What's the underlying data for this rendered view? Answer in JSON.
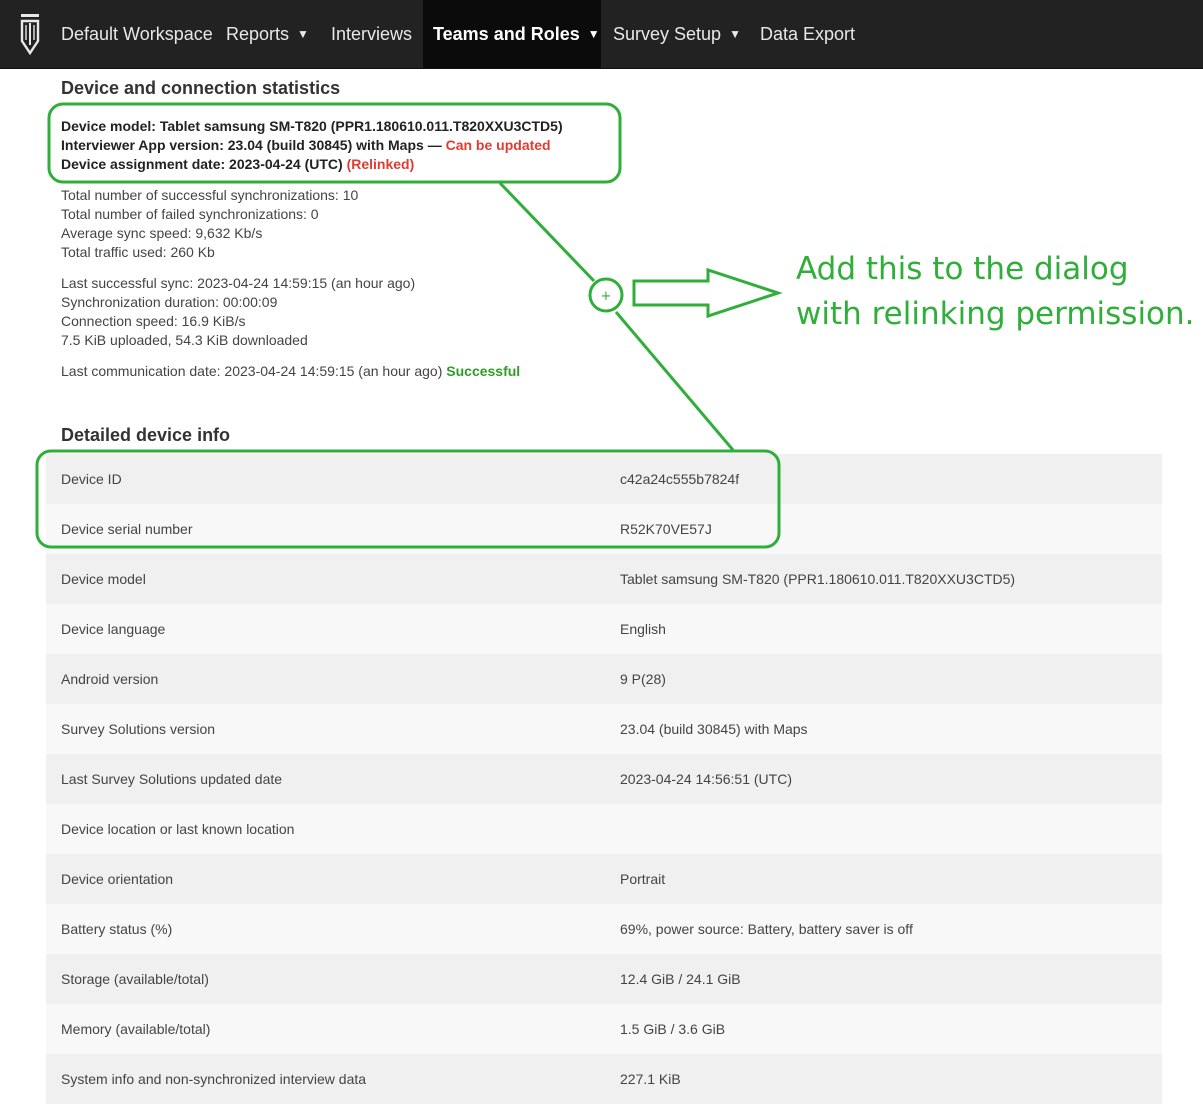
{
  "nav": {
    "items": [
      {
        "label": "Default Workspace",
        "caret": false
      },
      {
        "label": "Reports",
        "caret": true
      },
      {
        "label": "Interviews",
        "caret": false
      },
      {
        "label": "Teams and Roles",
        "caret": true,
        "active": true
      },
      {
        "label": "Survey Setup",
        "caret": true
      },
      {
        "label": "Data Export",
        "caret": false
      }
    ],
    "caret_glyph": "▼"
  },
  "stats": {
    "title": "Device and connection statistics",
    "device_model": "Device model: Tablet samsung SM-T820 (PPR1.180610.011.T820XXU3CTD5)",
    "app_version": "Interviewer App version: 23.04 (build 30845) with Maps —",
    "app_update": "Can be updated",
    "assignment_date": "Device assignment date: 2023-04-24 (UTC)",
    "relinked": "(Relinked)",
    "sync_success": "Total number of successful synchronizations: 10",
    "sync_failed": "Total number of failed synchronizations: 0",
    "avg_speed": "Average sync speed: 9,632 Kb/s",
    "traffic": "Total traffic used: 260 Kb",
    "last_sync": "Last successful sync: 2023-04-24 14:59:15 (an hour ago)",
    "sync_duration": "Synchronization duration: 00:00:09",
    "conn_speed": "Connection speed: 16.9 KiB/s",
    "transfer": "7.5 KiB uploaded, 54.3 KiB downloaded",
    "last_comm": "Last communication date: 2023-04-24 14:59:15 (an hour ago)",
    "last_comm_status": "Successful"
  },
  "details": {
    "title": "Detailed device info",
    "rows": [
      {
        "label": "Device ID",
        "value": "c42a24c555b7824f"
      },
      {
        "label": "Device serial number",
        "value": "R52K70VE57J"
      },
      {
        "label": "Device model",
        "value": "Tablet samsung SM-T820 (PPR1.180610.011.T820XXU3CTD5)"
      },
      {
        "label": "Device language",
        "value": "English"
      },
      {
        "label": "Android version",
        "value": "9 P(28)"
      },
      {
        "label": "Survey Solutions version",
        "value": "23.04 (build 30845) with Maps"
      },
      {
        "label": "Last Survey Solutions updated date",
        "value": "2023-04-24 14:56:51 (UTC)"
      },
      {
        "label": "Device location or last known location",
        "value": ""
      },
      {
        "label": "Device orientation",
        "value": "Portrait"
      },
      {
        "label": "Battery status (%)",
        "value": "69%, power source: Battery, battery saver is off"
      },
      {
        "label": "Storage (available/total)",
        "value": "12.4 GiB / 24.1 GiB"
      },
      {
        "label": "Memory (available/total)",
        "value": "1.5 GiB / 3.6 GiB"
      },
      {
        "label": "System info and non-synchronized interview data",
        "value": "227.1 KiB"
      }
    ]
  },
  "annotation": {
    "text": "Add this to the dialog with relinking permission.",
    "plus": "+",
    "color": "#2fae3a"
  }
}
